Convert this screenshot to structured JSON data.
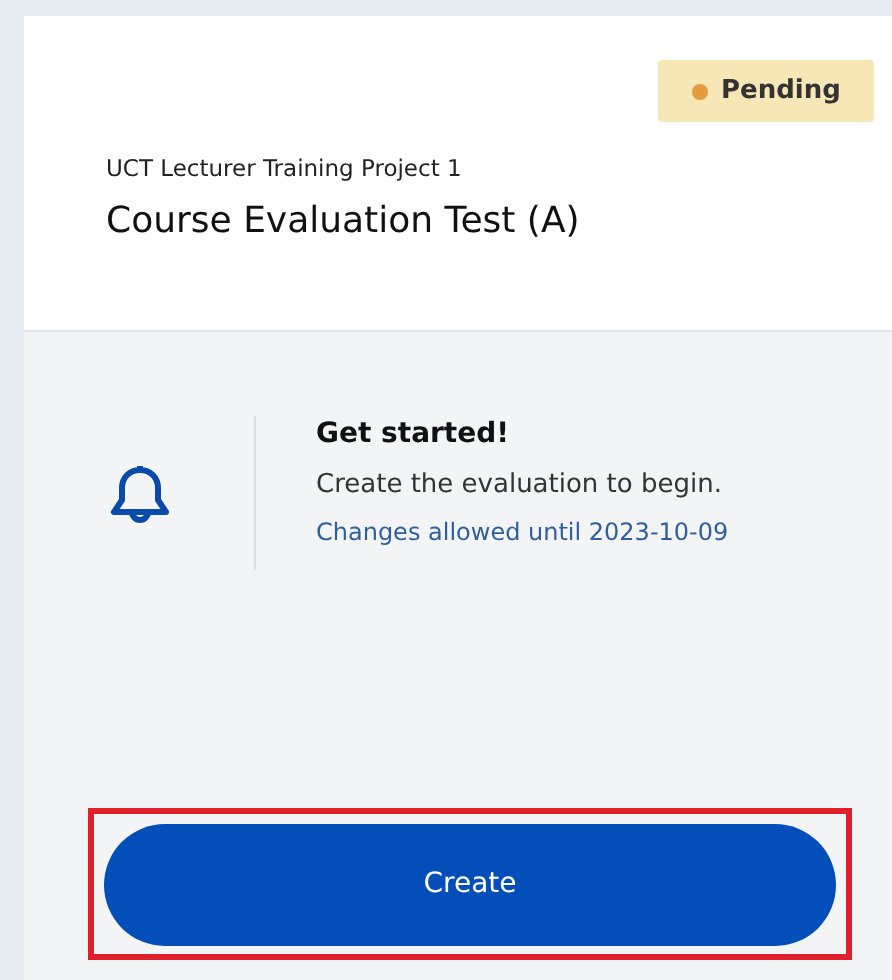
{
  "status_badge": {
    "label": "Pending",
    "color": "#e59a3e"
  },
  "project": "UCT Lecturer Training Project 1",
  "title": "Course Evaluation Test (A)",
  "notice": {
    "heading": "Get started!",
    "message": "Create the evaluation to begin.",
    "deadline": "Changes allowed until 2023-10-09"
  },
  "create_button": {
    "label": "Create",
    "highlighted": true
  }
}
